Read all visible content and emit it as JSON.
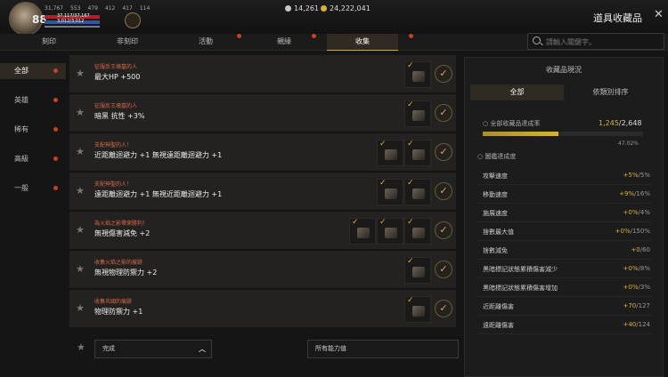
{
  "player": {
    "level": "88",
    "stat1": "31,767",
    "stat2": "553",
    "stat3": "479",
    "stat4": "412",
    "stat5": "417",
    "stat6": "114",
    "hp": "37,117/37,167",
    "mp": "3,012/3,012"
  },
  "currency": {
    "silver": "14,261",
    "gold": "24,222,041"
  },
  "window_title": "道具收藏品",
  "tabs": [
    "刻印",
    "非刻印",
    "活動",
    "親緣",
    "收集"
  ],
  "search_placeholder": "請輸入關鍵字。",
  "categories": [
    "全部",
    "英雄",
    "稀有",
    "高級",
    "一般"
  ],
  "items": [
    {
      "title": "征服反王墳墓的人",
      "effect": "最大HP +500"
    },
    {
      "title": "征服反王墳墓的人",
      "effect": "暗黑 抗性 +3%"
    },
    {
      "title": "支配神聖的人！",
      "effect": "近距離迴避力 +1 無視遠距離迴避力 +1"
    },
    {
      "title": "支配神聖的人！",
      "effect": "遠距離迴避力 +1 無視近距離迴避力 +1"
    },
    {
      "title": "為火焰之影帶來勝利！",
      "effect": "無視傷害減免 +2"
    },
    {
      "title": "收集火焰之影的痕跡",
      "effect": "無視物理防禦力 +2"
    },
    {
      "title": "收集炎國的痕跡",
      "effect": "物理防禦力 +1"
    }
  ],
  "filters": {
    "status": "完成",
    "ability": "所有能力值"
  },
  "panel": {
    "title": "收藏品現況",
    "tabs": [
      "全部",
      "依類別排序"
    ],
    "total_label": "全部收藏品達成率",
    "total_done": "1,245",
    "total_all": "/2,648",
    "percent": "47.02%",
    "progress": 0.4702,
    "section": "圖鑑達成度",
    "stats": [
      {
        "name": "攻擊速度",
        "cur": "+5%",
        "max": "/5%"
      },
      {
        "name": "移動速度",
        "cur": "+9%",
        "max": "/16%"
      },
      {
        "name": "施展速度",
        "cur": "+0%",
        "max": "/4%"
      },
      {
        "name": "捨數最大值",
        "cur": "+0%",
        "max": "/150%"
      },
      {
        "name": "捨數減免",
        "cur": "+0",
        "max": "/60"
      },
      {
        "name": "黑暗標記狀態累積傷害減少",
        "cur": "+0%",
        "max": "/8%"
      },
      {
        "name": "黑暗標記狀態累積傷害增加",
        "cur": "+0%",
        "max": "/3%"
      },
      {
        "name": "近距離傷害",
        "cur": "+70",
        "max": "/127"
      },
      {
        "name": "遠距離傷害",
        "cur": "+40",
        "max": "/124"
      }
    ]
  },
  "colors": {
    "accent": "#d8b03a",
    "alert": "#c8402a",
    "title_text": "#d46a4a"
  }
}
